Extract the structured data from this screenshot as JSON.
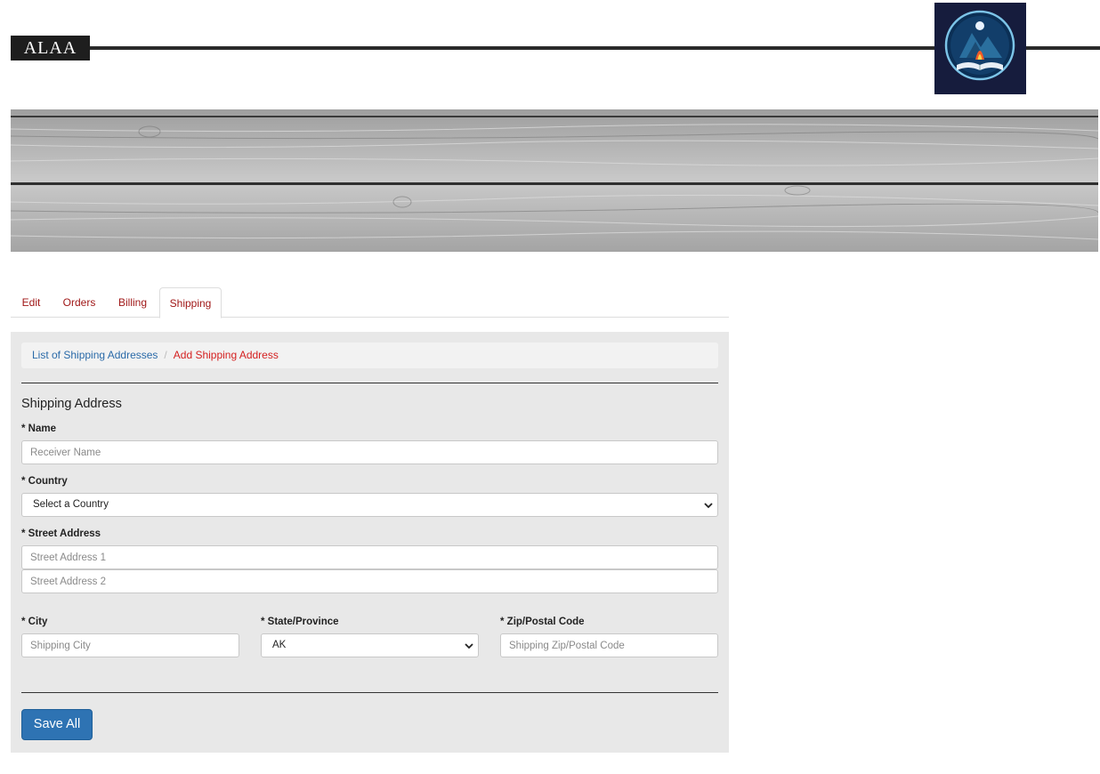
{
  "header": {
    "brand": "ALAA"
  },
  "tabs": [
    {
      "label": "Edit"
    },
    {
      "label": "Orders"
    },
    {
      "label": "Billing"
    },
    {
      "label": "Shipping"
    }
  ],
  "breadcrumb": {
    "link": "List of Shipping Addresses",
    "separator": "/",
    "current": "Add Shipping Address"
  },
  "form": {
    "title": "Shipping Address",
    "name": {
      "label": "* Name",
      "placeholder": "Receiver Name"
    },
    "country": {
      "label": "* Country",
      "value": "Select a Country"
    },
    "street": {
      "label": "* Street Address",
      "placeholder1": "Street Address 1",
      "placeholder2": "Street Address 2"
    },
    "city": {
      "label": "* City",
      "placeholder": "Shipping City"
    },
    "state": {
      "label": "* State/Province",
      "value": "AK"
    },
    "zip": {
      "label": "* Zip/Postal Code",
      "placeholder": "Shipping Zip/Postal Code"
    },
    "save_label": "Save All"
  },
  "colors": {
    "accent": "#2e73b3",
    "tab_text": "#a01818",
    "crumb_link": "#2a6aa8",
    "crumb_active": "#d42020"
  }
}
